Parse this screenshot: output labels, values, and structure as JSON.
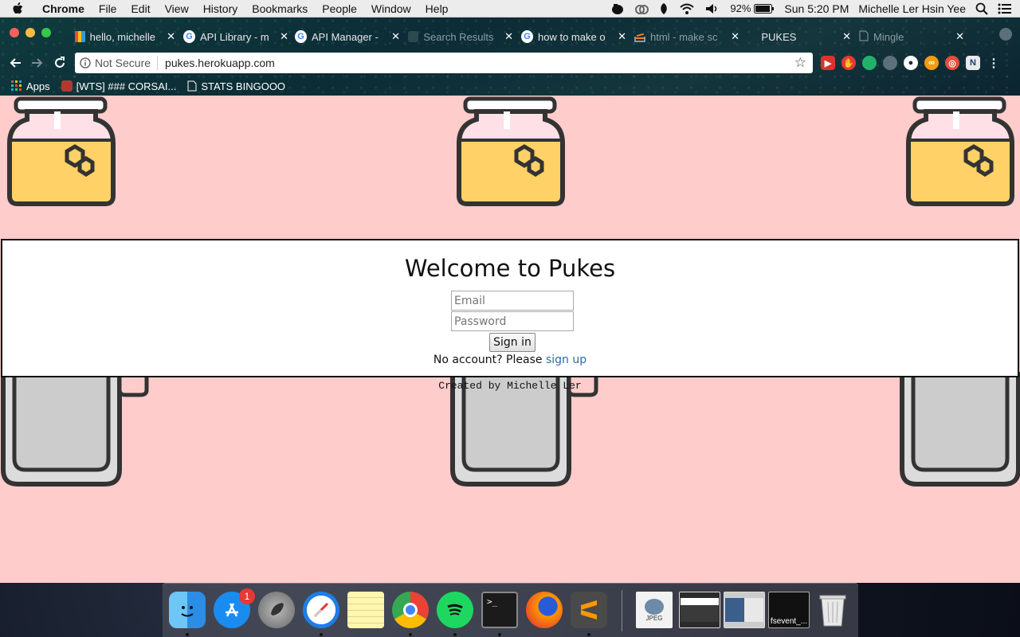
{
  "menubar": {
    "app_name": "Chrome",
    "menus": [
      "File",
      "Edit",
      "View",
      "History",
      "Bookmarks",
      "People",
      "Window",
      "Help"
    ],
    "battery": "92%",
    "clock": "Sun 5:20 PM",
    "user": "Michelle Ler Hsin Yee"
  },
  "tabs": [
    {
      "label": "hello, michelle",
      "icon": "app-favicon"
    },
    {
      "label": "API Library - m",
      "icon": "google-icon"
    },
    {
      "label": "API Manager -",
      "icon": "google-icon"
    },
    {
      "label": "Search Results",
      "icon": "page-favicon"
    },
    {
      "label": "how to make o",
      "icon": "google-icon"
    },
    {
      "label": "html - make sc",
      "icon": "stackoverflow-icon"
    },
    {
      "label": "PUKES",
      "icon": "page-favicon"
    },
    {
      "label": "Mingle",
      "icon": "document-icon"
    }
  ],
  "address_bar": {
    "security_label": "Not Secure",
    "url": "pukes.herokuapp.com"
  },
  "bookmarks": [
    {
      "label": "Apps",
      "icon": "apps-grid-icon"
    },
    {
      "label": "[WTS] ### CORSAI...",
      "icon": "bookmark-favicon"
    },
    {
      "label": "STATS BINGOOO",
      "icon": "document-icon"
    }
  ],
  "login": {
    "title": "Welcome to Pukes",
    "email_placeholder": "Email",
    "password_placeholder": "Password",
    "signin_label": "Sign in",
    "signup_prompt": "No account? Please",
    "signup_link": "sign up"
  },
  "footer": {
    "credit": "Created by Michelle Ler"
  },
  "dock": {
    "items": [
      "Finder",
      "App Store",
      "Launchpad",
      "Safari",
      "Notes",
      "Chrome",
      "Spotify",
      "Terminal",
      "Firefox",
      "Sublime Text"
    ],
    "app_store_badge": "1",
    "recent_items": [
      "JPEG",
      "screenshot",
      "screenshot",
      "fsevent_..."
    ],
    "trash": "Trash"
  },
  "colors": {
    "page_background": "#ffcccc",
    "link": "#2d6ca2",
    "honey": "#ffd166",
    "jar_outline": "#333333",
    "jar_empty": "#cccccc"
  }
}
